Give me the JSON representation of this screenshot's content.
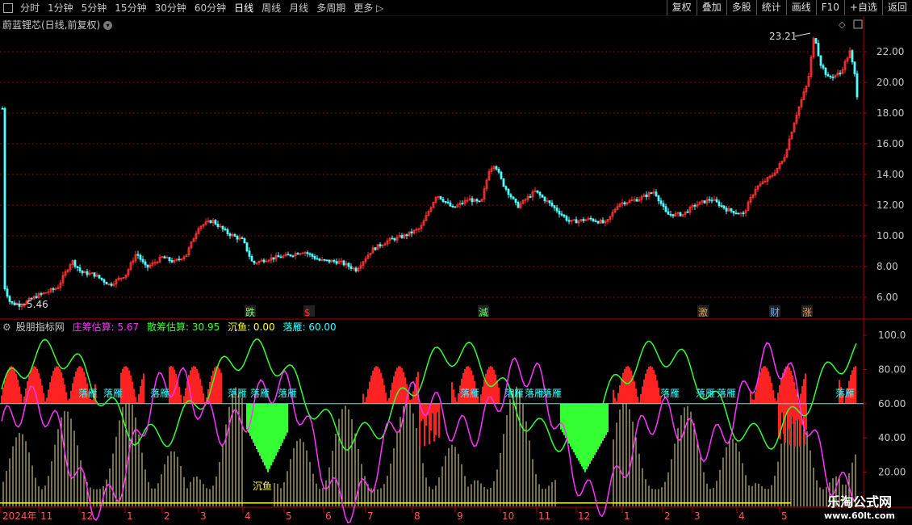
{
  "toolbar": {
    "periods": [
      "分时",
      "1分钟",
      "5分钟",
      "15分钟",
      "30分钟",
      "60分钟",
      "日线",
      "周线",
      "月线",
      "多周期",
      "更多"
    ],
    "active_period": "日线",
    "right_buttons": [
      "复权",
      "叠加",
      "多股",
      "统计",
      "画线",
      "F10",
      "+自选",
      "返回"
    ]
  },
  "main_title": "蔚蓝锂芯(日线,前复权)",
  "price_axis": [
    "22.00",
    "20.00",
    "18.00",
    "16.00",
    "14.00",
    "12.00",
    "10.00",
    "8.00",
    "6.00"
  ],
  "high_label": "23.21",
  "low_label": "5.46",
  "event_markers": [
    {
      "text": "跌",
      "color": "#66ff66"
    },
    {
      "text": "$",
      "color": "#ff3333"
    },
    {
      "text": "減",
      "color": "#66ff66"
    },
    {
      "text": "激",
      "color": "#ff9933"
    },
    {
      "text": "财",
      "color": "#66aaff"
    },
    {
      "text": "涨",
      "color": "#ff9933"
    }
  ],
  "indicator": {
    "name": "股朋指标网",
    "items": [
      {
        "label": "庄筹估算: 5.67",
        "color": "#ff33ff"
      },
      {
        "label": "散筹估算: 30.95",
        "color": "#33ff33"
      },
      {
        "label": "沉鱼: 0.00",
        "color": "#ffff33"
      },
      {
        "label": "落雁: 60.00",
        "color": "#33ffff"
      }
    ],
    "axis": [
      "100.0",
      "80.00",
      "60.00",
      "40.00",
      "20.00"
    ],
    "luoyan_label": "落雁",
    "chenyu_label": "沉鱼"
  },
  "date_axis": [
    "2024年",
    "11",
    "12",
    "1",
    "2",
    "3",
    "4",
    "5",
    "6",
    "7",
    "8",
    "9",
    "10",
    "11",
    "12",
    "1",
    "2",
    "3",
    "4",
    "5"
  ],
  "watermark": {
    "line1": "乐淘公式网",
    "line2": "www.60lt.com"
  },
  "colors": {
    "up": "#ff3232",
    "down": "#54ffff",
    "grid": "#8b0000",
    "axis_text": "#c8c8c8"
  }
}
